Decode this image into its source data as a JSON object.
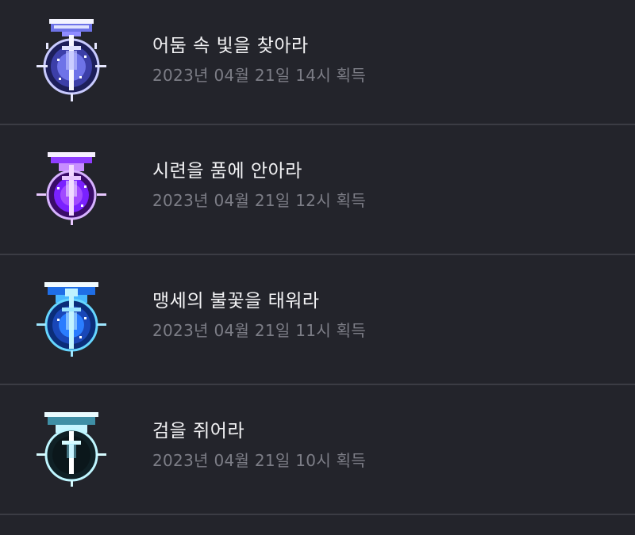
{
  "achievements": [
    {
      "title": "어둠 속 빛을 찾아라",
      "acquired": "2023년 04월 21일 14시 획득",
      "icon": "medal-purple-blue-icon",
      "colors": {
        "primary": "#8f8cff",
        "glow": "#dfe2ff",
        "dark": "#1d1f5a"
      }
    },
    {
      "title": "시련을 품에 안아라",
      "acquired": "2023년 04월 21일 12시 획득",
      "icon": "medal-violet-icon",
      "colors": {
        "primary": "#a24bff",
        "glow": "#f2d8ff",
        "dark": "#3a0c69"
      }
    },
    {
      "title": "맹세의 불꽃을 태워라",
      "acquired": "2023년 04월 21일 11시 획득",
      "icon": "medal-blue-flame-icon",
      "colors": {
        "primary": "#2a7dff",
        "glow": "#bff3ff",
        "dark": "#0b2d79"
      }
    },
    {
      "title": "검을 쥐어라",
      "acquired": "2023년 04월 21일 10시 획득",
      "icon": "medal-sword-icon",
      "colors": {
        "primary": "#88e6ff",
        "glow": "#ffffff",
        "dark": "#0f2025"
      }
    }
  ]
}
